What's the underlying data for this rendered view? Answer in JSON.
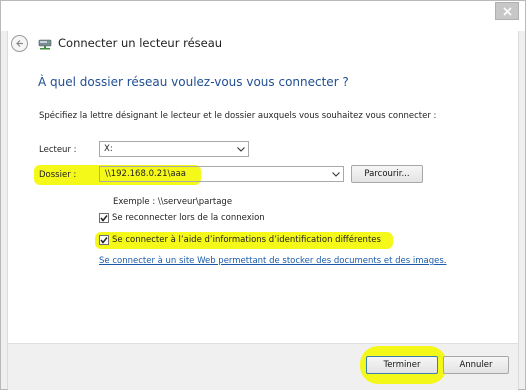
{
  "window": {
    "title": "Connecter un lecteur réseau"
  },
  "wizard": {
    "heading": "À quel dossier réseau voulez-vous vous connecter ?",
    "instruction": "Spécifiez la lettre désignant le lecteur et le dossier auxquels vous souhaitez vous connecter :"
  },
  "drive": {
    "label": "Lecteur :",
    "value": "X:"
  },
  "folder": {
    "label": "Dossier :",
    "value": "\\\\192.168.0.21\\aaa",
    "browse_label": "Parcourir..."
  },
  "example_text": "Exemple : \\\\serveur\\partage",
  "options": [
    {
      "label": "Se reconnecter lors de la connexion",
      "checked": true
    },
    {
      "label": "Se connecter à l’aide d’informations d’identification différentes",
      "checked": true
    }
  ],
  "web_link": "Se connecter à un site Web permettant de stocker des documents et des images",
  "web_link_suffix": ".",
  "buttons": {
    "finish": "Terminer",
    "cancel": "Annuler"
  },
  "colors": {
    "heading": "#1f4e94",
    "link": "#1a5aa8",
    "highlight": "#f4f800"
  }
}
